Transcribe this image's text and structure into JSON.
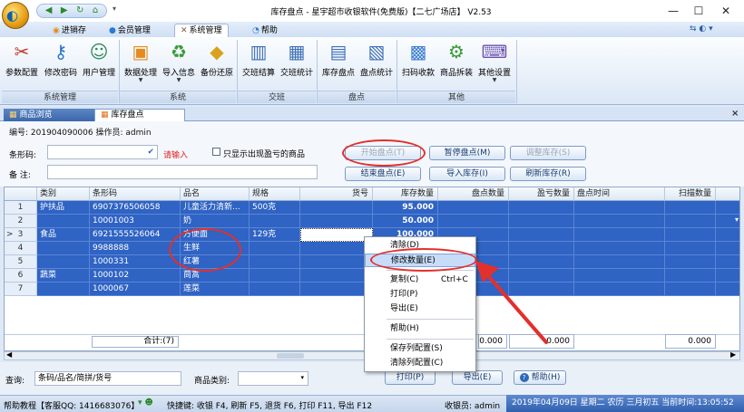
{
  "window": {
    "title": "库存盘点 - 星宇超市收银软件(免费版)【二七广场店】 V2.53",
    "min": "—",
    "max": "☐",
    "close": "✕"
  },
  "ribbon_tabs": [
    {
      "label": "进销存"
    },
    {
      "label": "会员管理"
    },
    {
      "label": "系统管理"
    },
    {
      "label": "帮助"
    }
  ],
  "ribbon_right": "⇆ ◐ ▾",
  "ribbon_buttons": [
    {
      "label": "参数配置",
      "icon": "✂",
      "color": "#c0392b"
    },
    {
      "label": "修改密码",
      "icon": "🔑",
      "color": "#2874c9"
    },
    {
      "label": "用户管理",
      "icon": "👥",
      "color": "#2e8b57"
    },
    {
      "label": "数据处理",
      "icon": "📦",
      "color": "#e58a1c"
    },
    {
      "label": "导入信息",
      "icon": "♻",
      "color": "#3a9a3a"
    },
    {
      "label": "备份还原",
      "icon": "◆",
      "color": "#d9a21a"
    },
    {
      "label": "交班结算",
      "icon": "📋",
      "color": "#3d6fb7"
    },
    {
      "label": "交班统计",
      "icon": "▦",
      "color": "#3d6fb7"
    },
    {
      "label": "库存盘点",
      "icon": "📱",
      "color": "#3d6fb7"
    },
    {
      "label": "盘点统计",
      "icon": "▤",
      "color": "#3d6fb7"
    },
    {
      "label": "扫码收款",
      "icon": "▩",
      "color": "#3d7fd0"
    },
    {
      "label": "商品拆装",
      "icon": "⚙",
      "color": "#3a9a3a"
    },
    {
      "label": "其他设置",
      "icon": "⌨",
      "color": "#6a4fb0"
    }
  ],
  "ribbon_groups": [
    "系统管理",
    "系统",
    "交班",
    "盘点",
    "其他"
  ],
  "doc_tabs": [
    {
      "label": "商品浏览"
    },
    {
      "label": "库存盘点"
    }
  ],
  "panel": {
    "info": "编号: 201904090006  操作员: admin",
    "barcode_label": "条形码:",
    "barcode_hint": "请输入",
    "checkbox_label": "只显示出现盈亏的商品",
    "note_label": "备  注:",
    "buttons": {
      "start": "开始盘点(T)",
      "pause": "暂停盘点(M)",
      "adjust": "调整库存(S)",
      "end": "结束盘点(E)",
      "import": "导入库存(I)",
      "refresh": "刷新库存(R)"
    }
  },
  "grid": {
    "columns": [
      "类别",
      "条形码",
      "品名",
      "规格",
      "货号",
      "库存数量",
      "盘点数量",
      "盈亏数量",
      "盘点时间",
      "扫描数量"
    ],
    "rows": [
      {
        "no": "1",
        "mark": "",
        "cat": "护扶品",
        "code": "6907376506058",
        "name": "儿童活力清新...",
        "spec": "500克",
        "stock": "95.000"
      },
      {
        "no": "2",
        "mark": "",
        "cat": "",
        "code": "10001003",
        "name": "奶",
        "spec": "",
        "stock": "50.000"
      },
      {
        "no": "3",
        "mark": ">",
        "cat": "食品",
        "code": "6921555526064",
        "name": "方便面",
        "spec": "129克",
        "stock": "100.000"
      },
      {
        "no": "4",
        "mark": "",
        "cat": "",
        "code": "9988888",
        "name": "生鲜",
        "spec": "",
        "stock": ""
      },
      {
        "no": "5",
        "mark": "",
        "cat": "",
        "code": "1000331",
        "name": "红薯",
        "spec": "",
        "stock": ""
      },
      {
        "no": "6",
        "mark": "",
        "cat": "蔬菜",
        "code": "1000102",
        "name": "茼蒿",
        "spec": "",
        "stock": ""
      },
      {
        "no": "7",
        "mark": "",
        "cat": "",
        "code": "1000067",
        "name": "莲菜",
        "spec": "",
        "stock": ""
      }
    ],
    "footer": {
      "total": "合计:(7)",
      "count": "0.000",
      "profit": "0.000",
      "scan": "0.000"
    }
  },
  "context_menu": {
    "clear": "清除(D)",
    "modify": "修改数量(E)",
    "copy": "复制(C)",
    "copy_key": "Ctrl+C",
    "print": "打印(P)",
    "export": "导出(E)",
    "help": "帮助(H)",
    "save_cols": "保存列配置(S)",
    "clear_cols": "清除列配置(C)"
  },
  "bottom": {
    "query_label": "查询:",
    "query_value": "条码/品名/简拼/货号",
    "category_label": "商品类别:",
    "print": "打印(P)",
    "export": "导出(E)",
    "help": "帮助(H)"
  },
  "status": {
    "help": "帮助教程【客服QQ: 1416683076】",
    "shortcuts": "快捷键: 收银 F4, 刷新 F5, 退货 F6, 打印 F11, 导出 F12",
    "cashier": "收银员: admin",
    "datetime": "2019年04月09日 星期二 农历 三月初五 当前时间:13:05:52"
  }
}
